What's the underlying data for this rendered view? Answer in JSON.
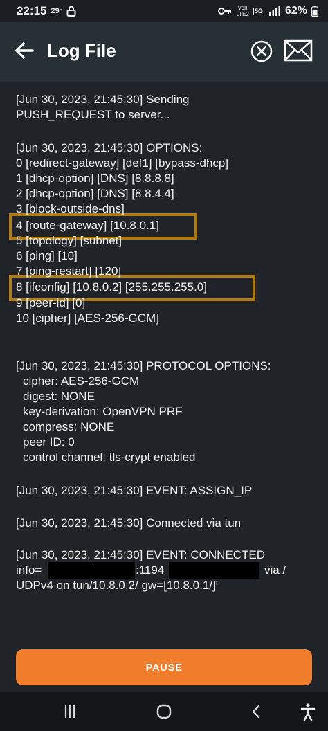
{
  "status_bar": {
    "time": "22:15",
    "temperature": "29°",
    "network_top": "Vol)",
    "network_bottom": "LTE2",
    "network_gen": "5G",
    "battery": "62%",
    "icons": [
      "lock-icon",
      "key-icon",
      "signal-icon",
      "battery-icon"
    ]
  },
  "app_bar": {
    "title": "Log File",
    "icons": [
      "back-arrow-icon",
      "clear-icon",
      "mail-icon"
    ]
  },
  "log": {
    "entries": [
      "[Jun 30, 2023, 21:45:30] Sending",
      "PUSH_REQUEST to server...",
      "[Jun 30, 2023, 21:45:30] OPTIONS:",
      "0 [redirect-gateway] [def1] [bypass-dhcp]",
      "1 [dhcp-option] [DNS] [8.8.8.8]",
      "2 [dhcp-option] [DNS] [8.8.4.4]",
      "3 [block-outside-dns]",
      "4 [route-gateway] [10.8.0.1]",
      "5 [topology] [subnet]",
      "6 [ping] [10]",
      "7 [ping-restart] [120]",
      "8 [ifconfig] [10.8.0.2] [255.255.255.0]",
      "9 [peer-id] [0]",
      "10 [cipher] [AES-256-GCM]",
      "[Jun 30, 2023, 21:45:30] PROTOCOL OPTIONS:",
      "cipher: AES-256-GCM",
      "digest: NONE",
      "key-derivation: OpenVPN PRF",
      "compress: NONE",
      "peer ID: 0",
      "control channel: tls-crypt enabled",
      "[Jun 30, 2023, 21:45:30] EVENT: ASSIGN_IP",
      "[Jun 30, 2023, 21:45:30] Connected via tun",
      "[Jun 30, 2023, 21:45:30] EVENT: CONNECTED",
      "info=",
      ":1194",
      "via /",
      "UDPv4 on tun/10.8.0.2/ gw=[10.8.0.1/]'"
    ],
    "highlight_color": "#b07b10"
  },
  "pause_button": {
    "label": "PAUSE",
    "color": "#ef7d2b"
  },
  "nav_bar": {
    "icons": [
      "recent-apps-icon",
      "home-icon",
      "back-icon",
      "accessibility-icon"
    ]
  }
}
